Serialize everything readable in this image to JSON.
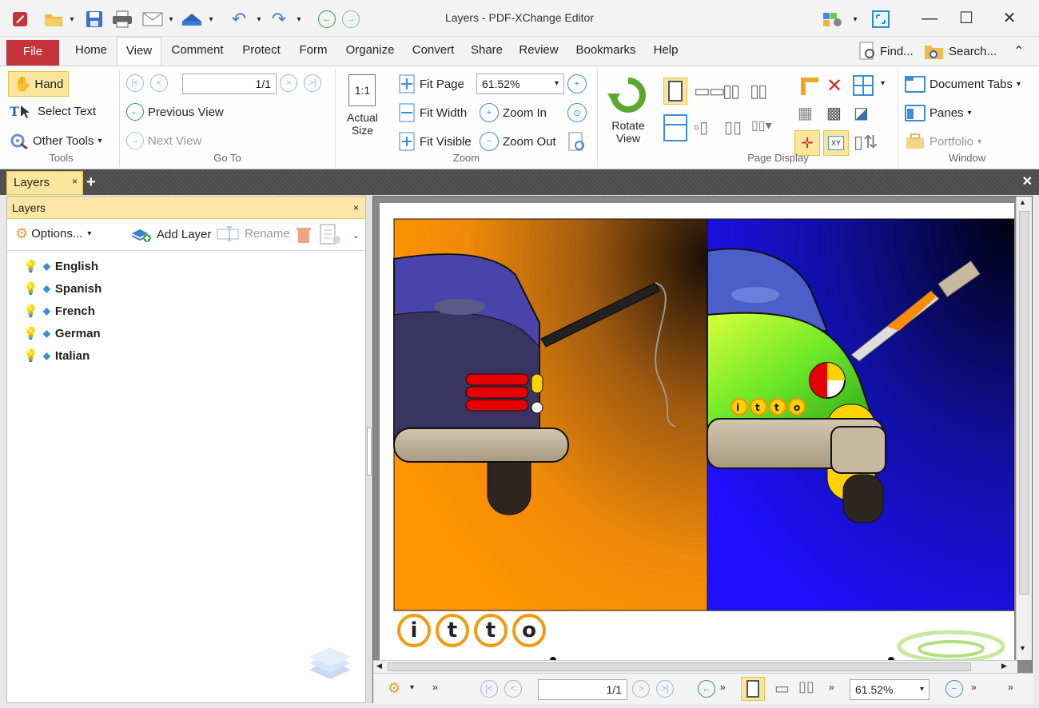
{
  "app": {
    "title": "Layers - PDF-XChange Editor"
  },
  "ribbon_tabs": [
    "File",
    "Home",
    "View",
    "Comment",
    "Protect",
    "Form",
    "Organize",
    "Convert",
    "Share",
    "Review",
    "Bookmarks",
    "Help"
  ],
  "find_label": "Find...",
  "search_label": "Search...",
  "tools": {
    "hand": "Hand",
    "select_text": "Select Text",
    "other_tools": "Other Tools",
    "group": "Tools"
  },
  "goto": {
    "page_field": "1/1",
    "previous_view": "Previous View",
    "next_view": "Next View",
    "group": "Go To"
  },
  "zoom": {
    "actual_size_line1": "Actual",
    "actual_size_line2": "Size",
    "actual_label": "1:1",
    "fit_page": "Fit Page",
    "zoom_value": "61.52%",
    "fit_width": "Fit Width",
    "zoom_in": "Zoom In",
    "fit_visible": "Fit Visible",
    "zoom_out": "Zoom Out",
    "group": "Zoom"
  },
  "rotate": {
    "line1": "Rotate",
    "line2": "View"
  },
  "page_display": {
    "group": "Page Display"
  },
  "window": {
    "document_tabs": "Document Tabs",
    "panes": "Panes",
    "portfolio": "Portfolio",
    "group": "Window"
  },
  "doc_tab": {
    "label": "Layers",
    "close": "×",
    "add": "+"
  },
  "layers_pane": {
    "title": "Layers",
    "close": "×",
    "options": "Options...",
    "add_layer": "Add Layer",
    "rename": "Rename",
    "items": [
      "English",
      "Spanish",
      "French",
      "German",
      "Italian"
    ]
  },
  "document": {
    "letters": [
      "i",
      "t",
      "t",
      "o"
    ]
  },
  "bottom": {
    "page_field": "1/1",
    "zoom_value": "61.52%"
  },
  "colors": {
    "file_tab": "#c4333a",
    "pane_header": "#fbe6a6",
    "accent": "#fbe69d"
  }
}
